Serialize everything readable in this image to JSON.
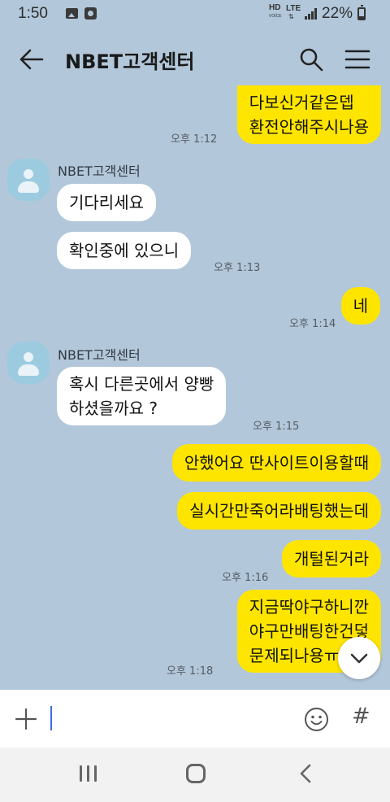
{
  "status_bar": {
    "time": "1:50",
    "network_hd": "HD",
    "network_voice": "VOICE",
    "network_type": "LTE",
    "battery": "22%"
  },
  "header": {
    "title": "NBET고객센터"
  },
  "messages": [
    {
      "from": "me",
      "lines": [
        "다보신거같은뎁",
        "환전안해주시나용"
      ],
      "time": "오후 1:12"
    },
    {
      "from": "other",
      "sender": "NBET고객센터",
      "text": "기다리세요"
    },
    {
      "from": "other",
      "text": "확인중에 있으니",
      "time": "오후 1:13"
    },
    {
      "from": "me",
      "text": "네",
      "time": "오후 1:14"
    },
    {
      "from": "other",
      "sender": "NBET고객센터",
      "lines": [
        "혹시 다른곳에서 양빵",
        "하셨을까요 ?"
      ],
      "time": "오후 1:15"
    },
    {
      "from": "me",
      "text": "안했어요 딴사이트이용할때"
    },
    {
      "from": "me",
      "text": "실시간만죽어라배팅했는데"
    },
    {
      "from": "me",
      "text": "개털된거라",
      "time": "오후 1:16"
    },
    {
      "from": "me",
      "lines": [
        "지금딱야구하니깐",
        "야구만배팅한건덯",
        "문제되나용ㅠ"
      ],
      "time": "오후 1:18"
    }
  ],
  "input": {
    "placeholder": "",
    "value": ""
  },
  "colors": {
    "background": "#b2c7da",
    "my_bubble": "#fee500",
    "other_bubble": "#ffffff",
    "avatar": "#9ccbe0"
  },
  "icons": [
    "back-arrow-icon",
    "search-icon",
    "menu-icon",
    "plus-icon",
    "emoji-icon",
    "hash-icon",
    "chevron-down-icon",
    "recents-icon",
    "home-icon",
    "back-nav-icon"
  ]
}
